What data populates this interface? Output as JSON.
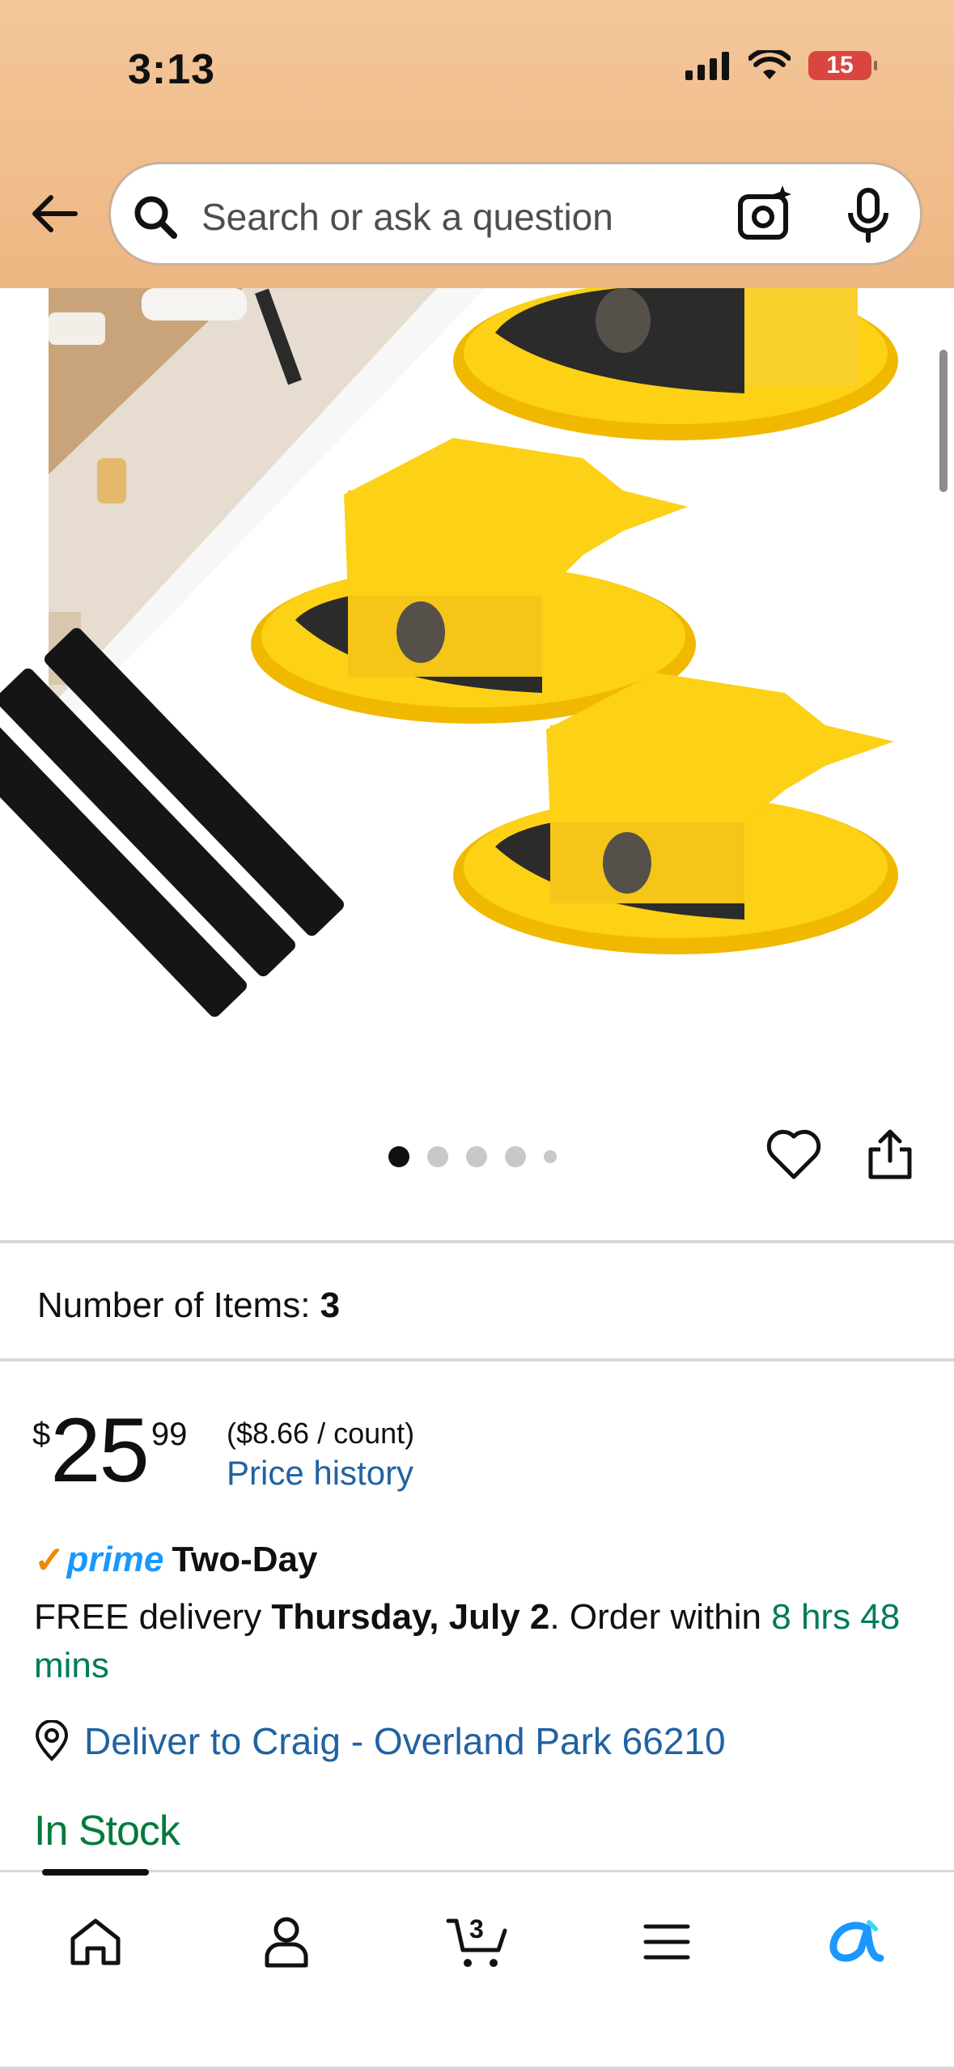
{
  "status_bar": {
    "time": "3:13",
    "battery": "15"
  },
  "search": {
    "placeholder": "Search or ask a question"
  },
  "carousel": {
    "dot_count": 5,
    "active_index": 0
  },
  "options": {
    "label": "Number of Items:",
    "value": "3"
  },
  "price": {
    "symbol": "$",
    "whole": "25",
    "fraction": "99",
    "unit_price": "($8.66 / count)",
    "history_link": "Price history"
  },
  "prime": {
    "check": "✓",
    "brand": "prime",
    "speed": "Two-Day"
  },
  "delivery": {
    "prefix": "FREE delivery ",
    "date": "Thursday, July 2",
    "middle": ". Order within ",
    "countdown": "8 hrs 48 mins"
  },
  "location": {
    "link": "Deliver to Craig - Overland Park 66210"
  },
  "stock": {
    "status": "In Stock"
  },
  "tab_bar": {
    "cart_count": "3",
    "items": [
      "home-icon",
      "account-icon",
      "cart-icon",
      "menu-icon",
      "rufus-icon"
    ]
  },
  "colors": {
    "header": "#f3c69a",
    "link": "#2162a1",
    "prime_blue": "#1a98ff",
    "prime_check": "#f08804",
    "in_stock": "#007a3d",
    "product_yellow": "#fcd116"
  }
}
